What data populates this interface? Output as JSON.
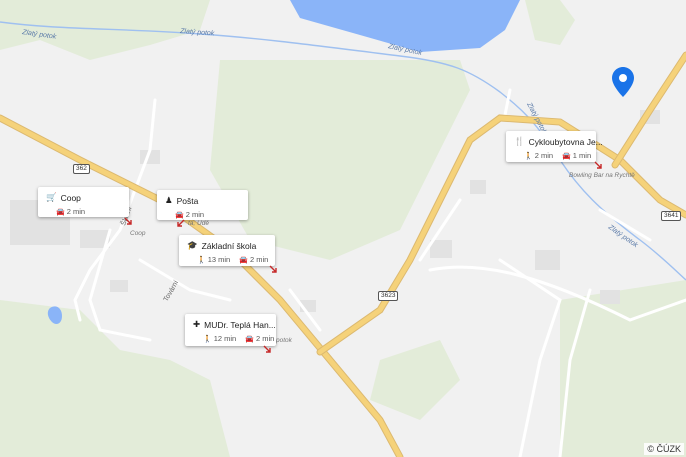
{
  "map": {
    "water_label": "Zlatý potok",
    "road_numbers": [
      "362",
      "3623",
      "3641"
    ],
    "streets": [
      "Tovární",
      "Tovární",
      "Školní"
    ],
    "poi_texts": [
      "Coop",
      "Bowling Bar na Rychtě",
      "potok",
      "ta, Údě"
    ],
    "copyright": "© ČÚZK"
  },
  "places": [
    {
      "icon": "cart-icon",
      "name": "Coop",
      "walk": "",
      "drive": "2 min"
    },
    {
      "icon": "post-icon",
      "name": "Pošta",
      "walk": "",
      "drive": "2 min"
    },
    {
      "icon": "school-icon",
      "name": "Základní škola",
      "walk": "13 min",
      "drive": "2 min"
    },
    {
      "icon": "medical-icon",
      "name": "MUDr. Teplá Han...",
      "walk": "12 min",
      "drive": "2 min"
    },
    {
      "icon": "restaurant-icon",
      "name": "Cykloubytovna Je...",
      "walk": "2 min",
      "drive": "1 min"
    }
  ],
  "colors": {
    "major_road": "#f5d27a",
    "water": "#8ab4f8",
    "green": "#e3ecd9",
    "pin": "#1a73e8"
  }
}
